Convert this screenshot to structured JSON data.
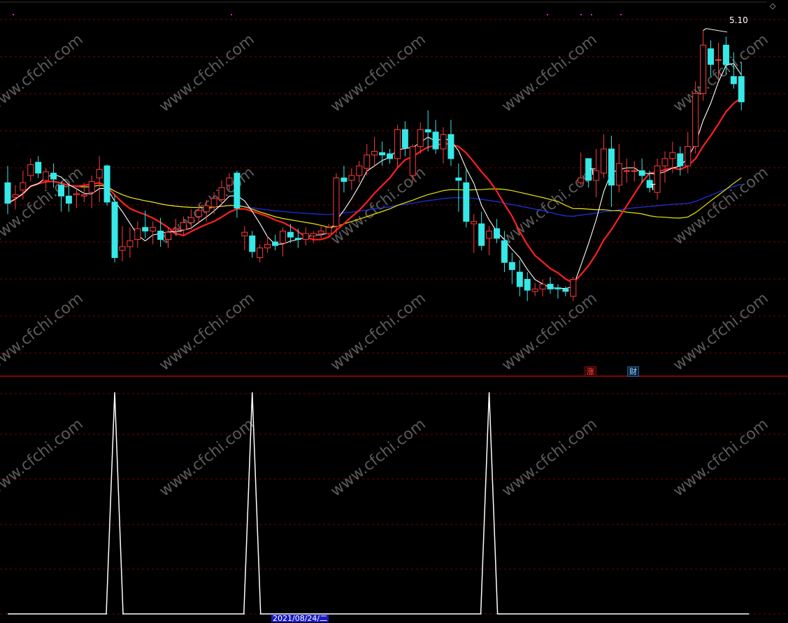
{
  "chart_data": [
    {
      "type": "candlestick",
      "panel": "price",
      "colors": {
        "up": "#ff3a3a",
        "down": "#36e8e8",
        "ma5": "#ffffff",
        "ma10": "#ff2020",
        "ma30": "#e8e800",
        "ma60": "#1f2fd8",
        "grid": "#7a0000",
        "separator": "#b00000",
        "background": "#000000"
      },
      "y_range": [
        2.4,
        5.18
      ],
      "high_label": "5.10",
      "t_markers": [
        "T",
        "T"
      ],
      "candles": [
        {
          "o": 3.84,
          "h": 3.98,
          "l": 3.58,
          "c": 3.67
        },
        {
          "o": 3.72,
          "h": 3.82,
          "l": 3.62,
          "c": 3.74
        },
        {
          "o": 3.78,
          "h": 3.94,
          "l": 3.7,
          "c": 3.84
        },
        {
          "o": 3.9,
          "h": 4.04,
          "l": 3.85,
          "c": 3.99
        },
        {
          "o": 4.01,
          "h": 4.06,
          "l": 3.88,
          "c": 3.92
        },
        {
          "o": 3.86,
          "h": 3.96,
          "l": 3.79,
          "c": 3.93
        },
        {
          "o": 3.92,
          "h": 4.0,
          "l": 3.8,
          "c": 3.87
        },
        {
          "o": 3.82,
          "h": 3.85,
          "l": 3.6,
          "c": 3.73
        },
        {
          "o": 3.73,
          "h": 3.82,
          "l": 3.6,
          "c": 3.67
        },
        {
          "o": 3.74,
          "h": 3.8,
          "l": 3.63,
          "c": 3.75
        },
        {
          "o": 3.73,
          "h": 3.84,
          "l": 3.68,
          "c": 3.74
        },
        {
          "o": 3.76,
          "h": 3.9,
          "l": 3.63,
          "c": 3.85
        },
        {
          "o": 3.88,
          "h": 4.06,
          "l": 3.68,
          "c": 3.95
        },
        {
          "o": 3.98,
          "h": 3.99,
          "l": 3.65,
          "c": 3.68
        },
        {
          "o": 3.68,
          "h": 3.74,
          "l": 3.18,
          "c": 3.22
        },
        {
          "o": 3.28,
          "h": 3.48,
          "l": 3.19,
          "c": 3.31
        },
        {
          "o": 3.31,
          "h": 3.47,
          "l": 3.22,
          "c": 3.36
        },
        {
          "o": 3.37,
          "h": 3.52,
          "l": 3.3,
          "c": 3.46
        },
        {
          "o": 3.47,
          "h": 3.61,
          "l": 3.38,
          "c": 3.44
        },
        {
          "o": 3.44,
          "h": 3.52,
          "l": 3.33,
          "c": 3.47
        },
        {
          "o": 3.44,
          "h": 3.55,
          "l": 3.31,
          "c": 3.37
        },
        {
          "o": 3.37,
          "h": 3.47,
          "l": 3.3,
          "c": 3.43
        },
        {
          "o": 3.45,
          "h": 3.54,
          "l": 3.4,
          "c": 3.46
        },
        {
          "o": 3.45,
          "h": 3.56,
          "l": 3.4,
          "c": 3.51
        },
        {
          "o": 3.51,
          "h": 3.62,
          "l": 3.45,
          "c": 3.55
        },
        {
          "o": 3.56,
          "h": 3.66,
          "l": 3.5,
          "c": 3.61
        },
        {
          "o": 3.6,
          "h": 3.7,
          "l": 3.52,
          "c": 3.65
        },
        {
          "o": 3.64,
          "h": 3.76,
          "l": 3.58,
          "c": 3.71
        },
        {
          "o": 3.7,
          "h": 3.86,
          "l": 3.64,
          "c": 3.8
        },
        {
          "o": 3.82,
          "h": 3.92,
          "l": 3.78,
          "c": 3.88
        },
        {
          "o": 3.92,
          "h": 3.94,
          "l": 3.55,
          "c": 3.63
        },
        {
          "o": 3.4,
          "h": 3.48,
          "l": 3.28,
          "c": 3.43
        },
        {
          "o": 3.4,
          "h": 3.44,
          "l": 3.22,
          "c": 3.27
        },
        {
          "o": 3.22,
          "h": 3.33,
          "l": 3.18,
          "c": 3.3
        },
        {
          "o": 3.3,
          "h": 3.4,
          "l": 3.26,
          "c": 3.33
        },
        {
          "o": 3.35,
          "h": 3.41,
          "l": 3.28,
          "c": 3.32
        },
        {
          "o": 3.34,
          "h": 3.47,
          "l": 3.23,
          "c": 3.44
        },
        {
          "o": 3.43,
          "h": 3.5,
          "l": 3.34,
          "c": 3.39
        },
        {
          "o": 3.38,
          "h": 3.46,
          "l": 3.3,
          "c": 3.37
        },
        {
          "o": 3.37,
          "h": 3.47,
          "l": 3.32,
          "c": 3.42
        },
        {
          "o": 3.4,
          "h": 3.44,
          "l": 3.34,
          "c": 3.42
        },
        {
          "o": 3.42,
          "h": 3.48,
          "l": 3.38,
          "c": 3.44
        },
        {
          "o": 3.42,
          "h": 3.5,
          "l": 3.4,
          "c": 3.47
        },
        {
          "o": 3.48,
          "h": 3.92,
          "l": 3.42,
          "c": 3.88
        },
        {
          "o": 3.88,
          "h": 3.98,
          "l": 3.76,
          "c": 3.85
        },
        {
          "o": 3.86,
          "h": 3.96,
          "l": 3.78,
          "c": 3.9
        },
        {
          "o": 3.9,
          "h": 4.02,
          "l": 3.84,
          "c": 3.98
        },
        {
          "o": 3.96,
          "h": 4.16,
          "l": 3.9,
          "c": 4.07
        },
        {
          "o": 4.07,
          "h": 4.22,
          "l": 3.98,
          "c": 4.1
        },
        {
          "o": 4.09,
          "h": 4.18,
          "l": 3.98,
          "c": 4.07
        },
        {
          "o": 4.08,
          "h": 4.12,
          "l": 4.0,
          "c": 4.04
        },
        {
          "o": 4.04,
          "h": 4.32,
          "l": 3.96,
          "c": 4.28
        },
        {
          "o": 4.28,
          "h": 4.35,
          "l": 4.06,
          "c": 4.13
        },
        {
          "o": 3.9,
          "h": 4.16,
          "l": 3.84,
          "c": 4.14
        },
        {
          "o": 4.14,
          "h": 4.34,
          "l": 4.08,
          "c": 4.28
        },
        {
          "o": 4.28,
          "h": 4.44,
          "l": 4.1,
          "c": 4.26
        },
        {
          "o": 4.26,
          "h": 4.36,
          "l": 4.08,
          "c": 4.12
        },
        {
          "o": 4.12,
          "h": 4.3,
          "l": 4.0,
          "c": 4.24
        },
        {
          "o": 4.24,
          "h": 4.36,
          "l": 3.98,
          "c": 4.04
        },
        {
          "o": 3.88,
          "h": 4.0,
          "l": 3.6,
          "c": 3.86
        },
        {
          "o": 3.84,
          "h": 3.96,
          "l": 3.47,
          "c": 3.52
        },
        {
          "o": 3.5,
          "h": 3.58,
          "l": 3.26,
          "c": 3.52
        },
        {
          "o": 3.5,
          "h": 3.6,
          "l": 3.28,
          "c": 3.32
        },
        {
          "o": 3.38,
          "h": 3.48,
          "l": 3.24,
          "c": 3.44
        },
        {
          "o": 3.46,
          "h": 3.54,
          "l": 3.34,
          "c": 3.38
        },
        {
          "o": 3.36,
          "h": 3.44,
          "l": 3.1,
          "c": 3.18
        },
        {
          "o": 3.18,
          "h": 3.26,
          "l": 3.0,
          "c": 3.12
        },
        {
          "o": 3.1,
          "h": 3.2,
          "l": 2.9,
          "c": 2.98
        },
        {
          "o": 3.04,
          "h": 3.1,
          "l": 2.86,
          "c": 2.95
        },
        {
          "o": 2.94,
          "h": 3.01,
          "l": 2.9,
          "c": 2.96
        },
        {
          "o": 2.96,
          "h": 3.04,
          "l": 2.9,
          "c": 3.0
        },
        {
          "o": 3.0,
          "h": 3.06,
          "l": 2.92,
          "c": 2.96
        },
        {
          "o": 2.97,
          "h": 3.0,
          "l": 2.88,
          "c": 2.96
        },
        {
          "o": 2.96,
          "h": 2.98,
          "l": 2.9,
          "c": 2.94
        },
        {
          "o": 2.9,
          "h": 3.06,
          "l": 2.86,
          "c": 3.04
        },
        {
          "o": 3.84,
          "h": 4.09,
          "l": 3.82,
          "c": 3.88
        },
        {
          "o": 4.04,
          "h": 4.04,
          "l": 3.8,
          "c": 3.86
        },
        {
          "o": 3.86,
          "h": 4.12,
          "l": 3.72,
          "c": 3.94
        },
        {
          "o": 3.92,
          "h": 4.24,
          "l": 3.88,
          "c": 4.12
        },
        {
          "o": 4.12,
          "h": 4.23,
          "l": 3.64,
          "c": 3.82
        },
        {
          "o": 3.82,
          "h": 4.16,
          "l": 3.76,
          "c": 4.0
        },
        {
          "o": 3.94,
          "h": 4.04,
          "l": 3.84,
          "c": 3.94
        },
        {
          "o": 3.94,
          "h": 4.02,
          "l": 3.85,
          "c": 3.94
        },
        {
          "o": 3.94,
          "h": 4.04,
          "l": 3.84,
          "c": 3.9
        },
        {
          "o": 3.86,
          "h": 3.94,
          "l": 3.76,
          "c": 3.8
        },
        {
          "o": 3.76,
          "h": 4.04,
          "l": 3.7,
          "c": 3.98
        },
        {
          "o": 3.98,
          "h": 4.1,
          "l": 3.84,
          "c": 4.04
        },
        {
          "o": 4.04,
          "h": 4.18,
          "l": 3.92,
          "c": 4.09
        },
        {
          "o": 4.08,
          "h": 4.14,
          "l": 3.9,
          "c": 3.98
        },
        {
          "o": 3.98,
          "h": 4.26,
          "l": 3.92,
          "c": 4.14
        },
        {
          "o": 4.14,
          "h": 4.68,
          "l": 4.08,
          "c": 4.58
        },
        {
          "o": 4.58,
          "h": 5.1,
          "l": 4.52,
          "c": 4.98
        },
        {
          "o": 4.95,
          "h": 5.02,
          "l": 4.72,
          "c": 4.82
        },
        {
          "o": 4.86,
          "h": 5.0,
          "l": 4.7,
          "c": 4.86
        },
        {
          "o": 4.98,
          "h": 5.05,
          "l": 4.74,
          "c": 4.82
        },
        {
          "o": 4.72,
          "h": 4.92,
          "l": 4.62,
          "c": 4.66
        },
        {
          "o": 4.72,
          "h": 4.84,
          "l": 4.44,
          "c": 4.51
        }
      ]
    },
    {
      "type": "line",
      "panel": "indicator",
      "color": "#ffffff",
      "y_range": [
        0,
        1
      ],
      "spikes_at_index": [
        14,
        32,
        63
      ],
      "values": [
        0,
        0,
        0,
        0,
        0,
        0,
        0,
        0,
        0,
        0,
        0,
        0,
        0,
        0,
        1,
        0,
        0,
        0,
        0,
        0,
        0,
        0,
        0,
        0,
        0,
        0,
        0,
        0,
        0,
        0,
        0,
        0,
        1,
        0,
        0,
        0,
        0,
        0,
        0,
        0,
        0,
        0,
        0,
        0,
        0,
        0,
        0,
        0,
        0,
        0,
        0,
        0,
        0,
        0,
        0,
        0,
        0,
        0,
        0,
        0,
        0,
        0,
        0,
        1,
        0,
        0,
        0,
        0,
        0,
        0,
        0,
        0,
        0,
        0,
        0,
        0,
        0,
        0,
        0,
        0,
        0,
        0,
        0,
        0,
        0,
        0,
        0,
        0,
        0,
        0,
        0,
        0,
        0,
        0,
        0,
        0,
        0,
        0
      ]
    }
  ],
  "labels": {
    "high": "5.10",
    "badge_zhang": "涨",
    "badge_cai": "财",
    "date": "2021/08/24/二",
    "corner_icon": "◇",
    "watermark": "www.cfchi.com"
  },
  "icons": {
    "corner": "diamond-icon"
  }
}
